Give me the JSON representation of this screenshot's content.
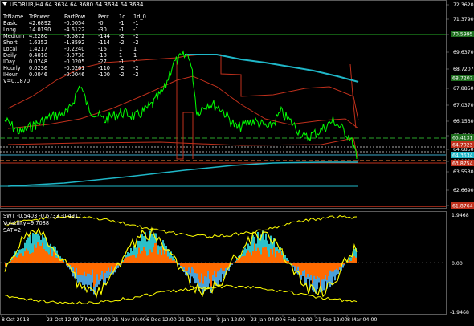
{
  "chart_title": "USDRUR,H4 64.3634 64.3680 64.3634 64.3634",
  "colors": {
    "background": "#000000",
    "price": "#00ff00",
    "ma_cyan": "#1fb7c8",
    "ma_red": "#c0301c",
    "yellow": "#ffff00",
    "orange": "#ff6a00",
    "level_green": "#1f6f1f"
  },
  "table": {
    "headers": [
      "TrName",
      "TrPower",
      "PartPow",
      "Perc",
      "1d",
      "1d_0"
    ],
    "rows": [
      [
        "Basic",
        "42.6892",
        "-0.0054",
        "-0",
        "-1",
        "-1"
      ],
      [
        "Long",
        "14.0190",
        "-4.6122",
        "-30",
        "-1",
        "-1"
      ],
      [
        "Medium",
        "4.2280",
        "-6.0872",
        "-144",
        "-2",
        "-2"
      ],
      [
        "Short",
        "1.6352",
        "-1.8592",
        "-114",
        "-2",
        "-2"
      ],
      [
        "Local",
        "1.4217",
        "-0.2240",
        "-16",
        "1",
        "1"
      ],
      [
        "Daily",
        "0.4010",
        "-0.0738",
        "-18",
        "1",
        "1"
      ],
      [
        "IDay",
        "0.0748",
        "-0.0205",
        "-27",
        "-1",
        "-1"
      ],
      [
        "Hourly",
        "0.0236",
        "-0.0261",
        "-110",
        "-2",
        "-2"
      ],
      [
        "IHour",
        "0.0046",
        "-0.0046",
        "-100",
        "-2",
        "-2"
      ]
    ],
    "footer": "V=0.1870"
  },
  "price_axis_labels": [
    "72.3620",
    "71.3790",
    "70.5995",
    "69.6370",
    "68.7207",
    "67.8850",
    "67.0370",
    "66.1530",
    "65.4131",
    "64.6850",
    "64.1000",
    "63.5530",
    "62.6690",
    "61.8760"
  ],
  "price_axis_highlights": [
    {
      "label": "70.5995",
      "color": "#1f6f1f"
    },
    {
      "label": "68.7207",
      "color": "#1f6f1f"
    },
    {
      "label": "65.4131",
      "color": "#1f6f1f"
    },
    {
      "label": "64.7023",
      "color": "#c0301c"
    },
    {
      "label": "64.3634",
      "color": "#1fb7c8"
    },
    {
      "label": "63.8754",
      "color": "#c0301c"
    },
    {
      "label": "61.8764",
      "color": "#c0301c"
    }
  ],
  "indicator": {
    "line1": "SWT -0.5403 -0.6733 -0.4917",
    "line2": "Volatility=9.7088",
    "line3": "SAT=2",
    "axis_labels": [
      "1.9468",
      "0.00",
      "-1.9468"
    ]
  },
  "time_axis_labels": [
    "8 Oct 2018",
    "23 Oct 12:00",
    "7 Nov 04:00",
    "21 Nov 20:00",
    "6 Dec 12:00",
    "21 Dec 04:00",
    "8 Jan 12:00",
    "23 Jan 04:00",
    "6 Feb 20:00",
    "21 Feb 12:00",
    "8 Mar 04:00"
  ]
}
